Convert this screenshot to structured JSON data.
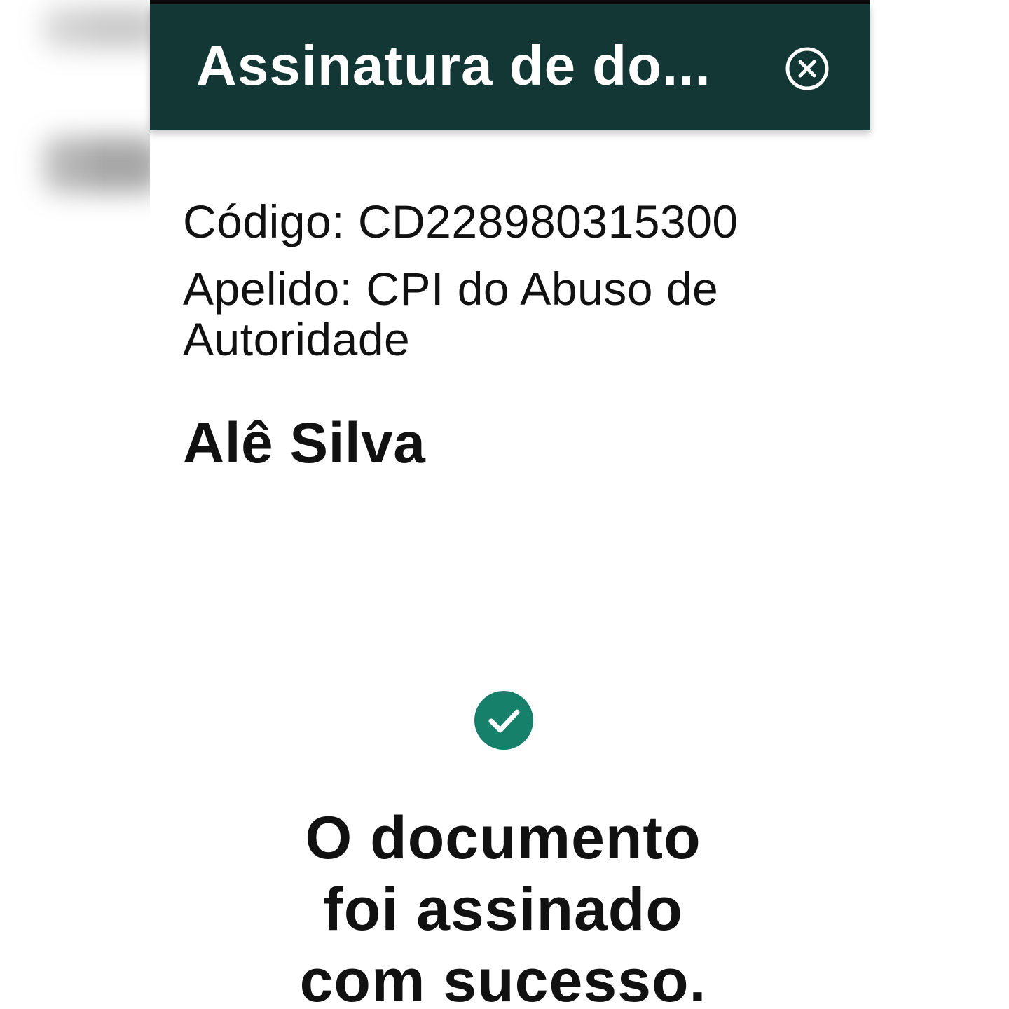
{
  "header": {
    "title": "Assinatura de do...",
    "close_icon": "close-circle-icon"
  },
  "document": {
    "code_text": "Código: CD228980315300",
    "nickname_text": "Apelido: CPI do Abuso de Autoridade"
  },
  "signer": {
    "name": "Alê Silva"
  },
  "status": {
    "icon": "check-circle-icon",
    "message": "O documento foi assinado com sucesso."
  },
  "colors": {
    "header_bg": "#133735",
    "success_green": "#16806b",
    "text": "#111111"
  }
}
